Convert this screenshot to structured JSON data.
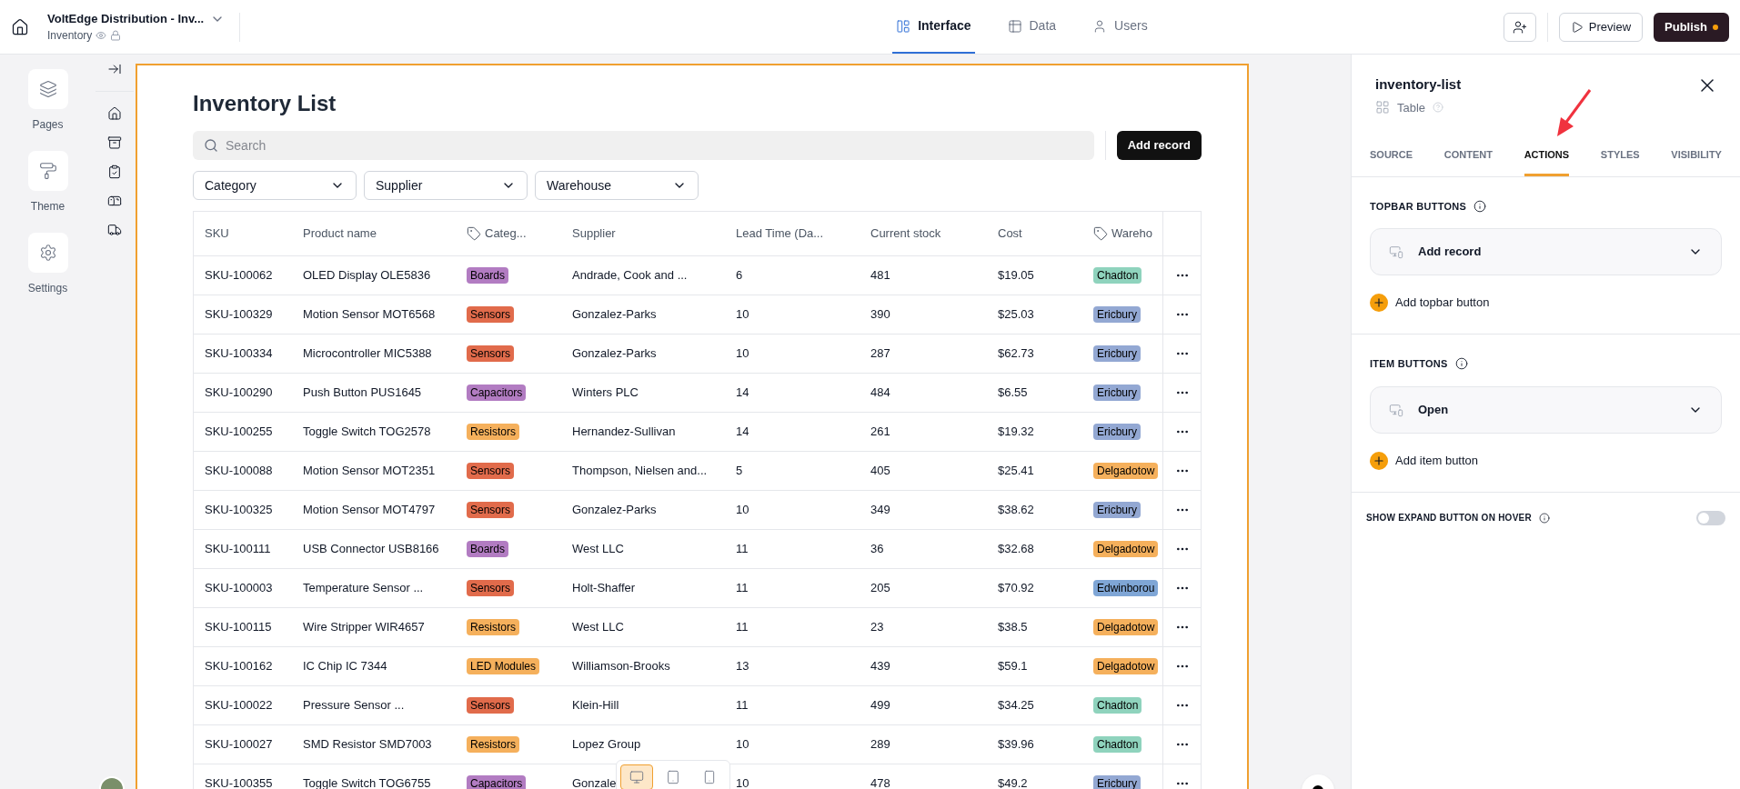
{
  "app": {
    "title": "VoltEdge Distribution - Inv...",
    "subtitle": "Inventory"
  },
  "nav_tabs": [
    {
      "label": "Interface",
      "selected": true
    },
    {
      "label": "Data",
      "selected": false
    },
    {
      "label": "Users",
      "selected": false
    }
  ],
  "header_buttons": {
    "preview": "Preview",
    "publish": "Publish"
  },
  "left_rail": [
    {
      "label": "Pages"
    },
    {
      "label": "Theme"
    },
    {
      "label": "Settings"
    }
  ],
  "page": {
    "title": "Inventory List",
    "search": {
      "placeholder": "Search"
    },
    "add_button": "Add record",
    "filters": [
      "Category",
      "Supplier",
      "Warehouse"
    ],
    "columns": [
      {
        "label": "SKU",
        "tag": false
      },
      {
        "label": "Product name",
        "tag": false
      },
      {
        "label": "Categ...",
        "tag": true
      },
      {
        "label": "Supplier",
        "tag": false
      },
      {
        "label": "Lead Time (Da...",
        "tag": false
      },
      {
        "label": "Current stock",
        "tag": false
      },
      {
        "label": "Cost",
        "tag": false
      },
      {
        "label": "Wareho",
        "tag": true
      }
    ],
    "rows": [
      {
        "sku": "SKU-100062",
        "product": "OLED Display OLE5836",
        "category": {
          "label": "Boards",
          "color": "#b27cc2"
        },
        "supplier": "Andrade, Cook and ...",
        "lead_time": "6",
        "stock": "481",
        "cost": "$19.05",
        "warehouse": {
          "label": "Chadton",
          "color": "#8fd3bd"
        }
      },
      {
        "sku": "SKU-100329",
        "product": "Motion Sensor MOT6568",
        "category": {
          "label": "Sensors",
          "color": "#e16b4b"
        },
        "supplier": "Gonzalez-Parks",
        "lead_time": "10",
        "stock": "390",
        "cost": "$25.03",
        "warehouse": {
          "label": "Ericbury",
          "color": "#93a8d3"
        }
      },
      {
        "sku": "SKU-100334",
        "product": "Microcontroller MIC5388",
        "category": {
          "label": "Sensors",
          "color": "#e16b4b"
        },
        "supplier": "Gonzalez-Parks",
        "lead_time": "10",
        "stock": "287",
        "cost": "$62.73",
        "warehouse": {
          "label": "Ericbury",
          "color": "#93a8d3"
        }
      },
      {
        "sku": "SKU-100290",
        "product": "Push Button PUS1645",
        "category": {
          "label": "Capacitors",
          "color": "#b27cc2"
        },
        "supplier": "Winters PLC",
        "lead_time": "14",
        "stock": "484",
        "cost": "$6.55",
        "warehouse": {
          "label": "Ericbury",
          "color": "#93a8d3"
        }
      },
      {
        "sku": "SKU-100255",
        "product": "Toggle Switch TOG2578",
        "category": {
          "label": "Resistors",
          "color": "#f5b05c"
        },
        "supplier": "Hernandez-Sullivan",
        "lead_time": "14",
        "stock": "261",
        "cost": "$19.32",
        "warehouse": {
          "label": "Ericbury",
          "color": "#93a8d3"
        }
      },
      {
        "sku": "SKU-100088",
        "product": "Motion Sensor MOT2351",
        "category": {
          "label": "Sensors",
          "color": "#e16b4b"
        },
        "supplier": "Thompson, Nielsen and...",
        "lead_time": "5",
        "stock": "405",
        "cost": "$25.41",
        "warehouse": {
          "label": "Delgadotow",
          "color": "#f5b05c"
        }
      },
      {
        "sku": "SKU-100325",
        "product": "Motion Sensor MOT4797",
        "category": {
          "label": "Sensors",
          "color": "#e16b4b"
        },
        "supplier": "Gonzalez-Parks",
        "lead_time": "10",
        "stock": "349",
        "cost": "$38.62",
        "warehouse": {
          "label": "Ericbury",
          "color": "#93a8d3"
        }
      },
      {
        "sku": "SKU-100111",
        "product": "USB Connector USB8166",
        "category": {
          "label": "Boards",
          "color": "#b27cc2"
        },
        "supplier": "West LLC",
        "lead_time": "11",
        "stock": "36",
        "cost": "$32.68",
        "warehouse": {
          "label": "Delgadotow",
          "color": "#f5b05c"
        }
      },
      {
        "sku": "SKU-100003",
        "product": "Temperature Sensor ...",
        "category": {
          "label": "Sensors",
          "color": "#e16b4b"
        },
        "supplier": "Holt-Shaffer",
        "lead_time": "11",
        "stock": "205",
        "cost": "$70.92",
        "warehouse": {
          "label": "Edwinborou",
          "color": "#7fa6d6"
        }
      },
      {
        "sku": "SKU-100115",
        "product": "Wire Stripper WIR4657",
        "category": {
          "label": "Resistors",
          "color": "#f5b05c"
        },
        "supplier": "West LLC",
        "lead_time": "11",
        "stock": "23",
        "cost": "$38.5",
        "warehouse": {
          "label": "Delgadotow",
          "color": "#f5b05c"
        }
      },
      {
        "sku": "SKU-100162",
        "product": "IC Chip IC 7344",
        "category": {
          "label": "LED Modules",
          "color": "#f5b05c"
        },
        "supplier": "Williamson-Brooks",
        "lead_time": "13",
        "stock": "439",
        "cost": "$59.1",
        "warehouse": {
          "label": "Delgadotow",
          "color": "#f5b05c"
        }
      },
      {
        "sku": "SKU-100022",
        "product": "Pressure Sensor ...",
        "category": {
          "label": "Sensors",
          "color": "#e16b4b"
        },
        "supplier": "Klein-Hill",
        "lead_time": "11",
        "stock": "499",
        "cost": "$34.25",
        "warehouse": {
          "label": "Chadton",
          "color": "#8fd3bd"
        }
      },
      {
        "sku": "SKU-100027",
        "product": "SMD Resistor SMD7003",
        "category": {
          "label": "Resistors",
          "color": "#f5b05c"
        },
        "supplier": "Lopez Group",
        "lead_time": "10",
        "stock": "289",
        "cost": "$39.96",
        "warehouse": {
          "label": "Chadton",
          "color": "#8fd3bd"
        }
      },
      {
        "sku": "SKU-100355",
        "product": "Toggle Switch TOG6755",
        "category": {
          "label": "Capacitors",
          "color": "#b27cc2"
        },
        "supplier": "Gonzale",
        "lead_time": "10",
        "stock": "478",
        "cost": "$49.2",
        "warehouse": {
          "label": "Ericbury",
          "color": "#93a8d3"
        }
      }
    ]
  },
  "device_toggle": [
    {
      "selected": true
    },
    {
      "selected": false
    },
    {
      "selected": false
    }
  ],
  "panel": {
    "title": "inventory-list",
    "type": "Table",
    "tabs": [
      {
        "label": "SOURCE",
        "selected": false
      },
      {
        "label": "CONTENT",
        "selected": false
      },
      {
        "label": "ACTIONS",
        "selected": true
      },
      {
        "label": "STYLES",
        "selected": false
      },
      {
        "label": "VISIBILITY",
        "selected": false
      }
    ],
    "sections": [
      {
        "heading": "TOPBAR BUTTONS",
        "item": "Add record",
        "add": "Add topbar button"
      },
      {
        "heading": "ITEM BUTTONS",
        "item": "Open",
        "add": "Add item button"
      }
    ],
    "toggle": {
      "label": "SHOW EXPAND BUTTON ON HOVER",
      "on": false
    }
  }
}
